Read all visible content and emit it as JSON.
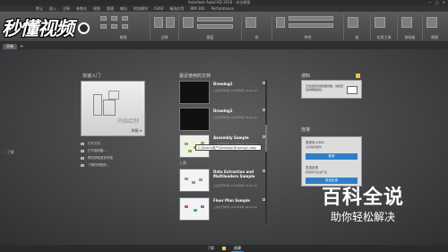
{
  "app": {
    "title": "Autodesk AutoCAD 2016 - 未注册版",
    "window_buttons": [
      "—",
      "□",
      "✕"
    ]
  },
  "menubar": {
    "items": [
      "默认",
      "插入",
      "注释",
      "参数化",
      "视图",
      "管理",
      "输出",
      "附加模块",
      "A360",
      "精选应用",
      "BIM 360",
      "Performance"
    ]
  },
  "ribbon": {
    "groups": [
      "绘图",
      "修改",
      "注释",
      "图层",
      "块",
      "特性",
      "组",
      "实用工具",
      "剪贴板",
      "视图"
    ]
  },
  "logo": {
    "text": "秒懂视频"
  },
  "doc_tabs": {
    "tabs": [
      "开始"
    ],
    "add_tab": "+"
  },
  "left_side": {
    "label": "了解"
  },
  "start": {
    "title": "快速入门",
    "card_label": "开始绘制",
    "template_dropdown": "样板 ▾",
    "links": [
      "打开文件...",
      "打开图纸集...",
      "联机获取更多样板",
      "了解样例图形..."
    ]
  },
  "recent": {
    "title": "最近使用的文档",
    "items": [
      {
        "name": "Drawing1",
        "meta": "上次打开时间 2016年8月 19:00:00"
      },
      {
        "name": "Drawing1",
        "meta": "上次打开时间 2016年8月 19:00:00"
      },
      {
        "name": "Assembly Sample",
        "meta": "上次打开时间 2016年8月 19:00:00"
      },
      {
        "name": "Data Extraction and Multileaders Sample",
        "meta": "上次打开时间 2016年8月 19:00:00"
      },
      {
        "name": "Floor Plan Sample",
        "meta": "上次打开时间 2016年8月 19:00:00"
      }
    ],
    "sub_label": "上周",
    "tooltip": "C:\\Users\\用户\\Desktop\\Drawing1.dwg"
  },
  "notify": {
    "title": "通知",
    "text": "无法连接到通知服务器，请检查您的网络连接。"
  },
  "connect": {
    "title": "连接",
    "login_title": "登录到 A360",
    "login_desc": "访问联机服务",
    "login_button": "登录",
    "feedback_title": "发送反馈",
    "feedback_desc": "帮助我们改进产品",
    "feedback_button": "发送反馈"
  },
  "statusbar": {
    "tabs": [
      "了解",
      "创建"
    ],
    "active": "创建"
  },
  "watermark": {
    "line1": "百科全说",
    "line2": "助你轻松解决"
  }
}
